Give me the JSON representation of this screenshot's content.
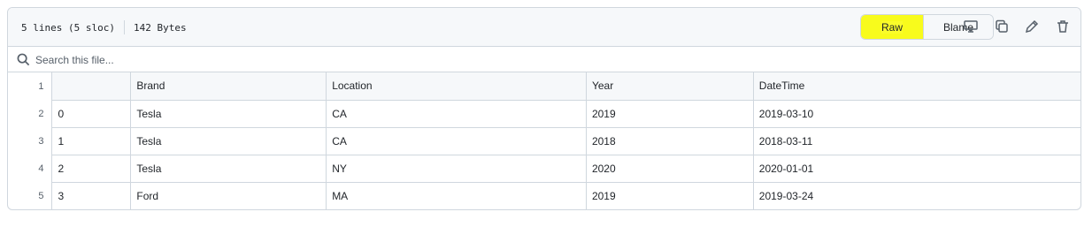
{
  "file_info": {
    "lines": "5 lines (5 sloc)",
    "size": "142 Bytes"
  },
  "toolbar": {
    "raw_label": "Raw",
    "blame_label": "Blame",
    "icons": [
      "display-icon",
      "copy-icon",
      "pencil-icon",
      "trash-icon"
    ]
  },
  "search": {
    "placeholder": "Search this file..."
  },
  "table": {
    "line_numbers": [
      "1",
      "2",
      "3",
      "4",
      "5"
    ],
    "headers": [
      "",
      "Brand",
      "Location",
      "Year",
      "DateTime"
    ],
    "rows": [
      [
        "0",
        "Tesla",
        "CA",
        "2019",
        "2019-03-10"
      ],
      [
        "1",
        "Tesla",
        "CA",
        "2018",
        "2018-03-11"
      ],
      [
        "2",
        "Tesla",
        "NY",
        "2020",
        "2020-01-01"
      ],
      [
        "3",
        "Ford",
        "MA",
        "2019",
        "2019-03-24"
      ]
    ]
  },
  "colors": {
    "highlight": "#f8fb1c",
    "border": "#d0d7de",
    "header_bg": "#f6f8fa"
  }
}
